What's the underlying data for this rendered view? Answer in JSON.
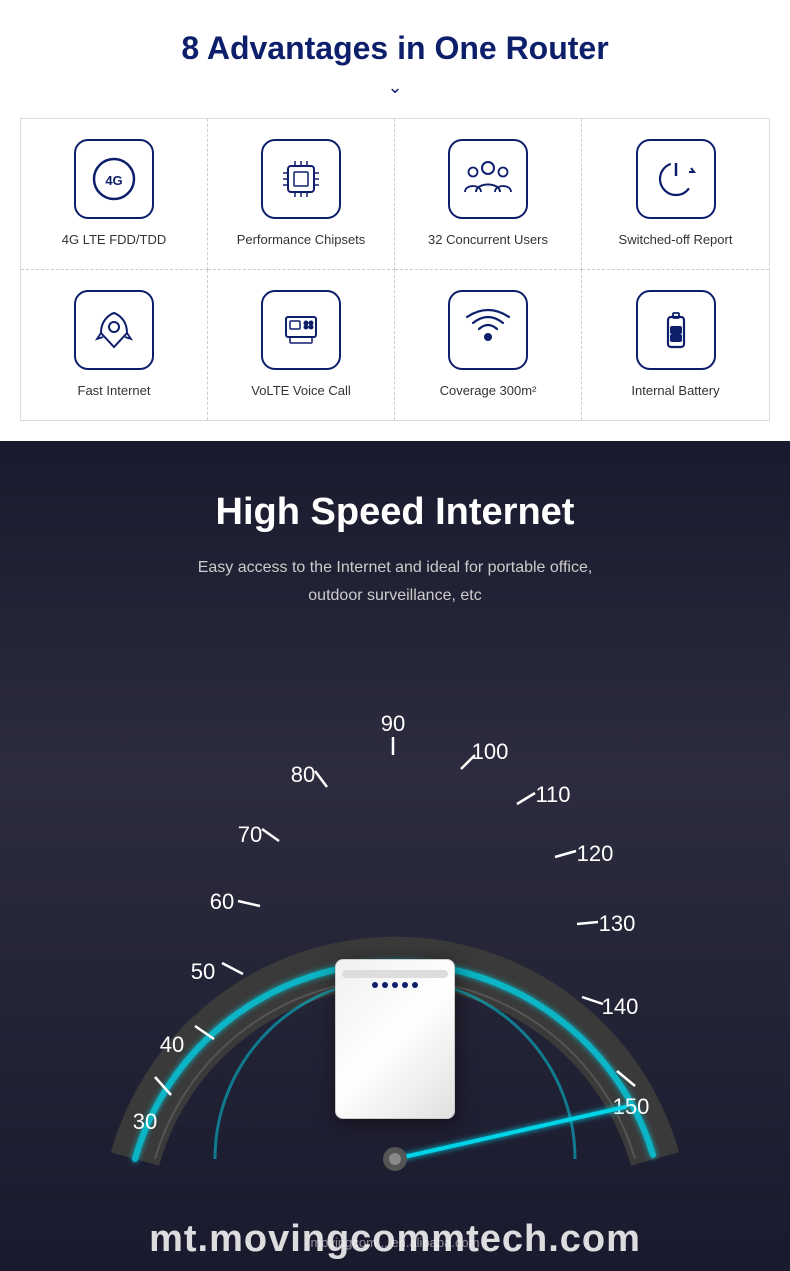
{
  "advantages": {
    "title": "8 Advantages in One Router",
    "items": [
      {
        "id": "4g-lte",
        "label": "4G LTE FDD/TDD",
        "icon": "4g"
      },
      {
        "id": "chipset",
        "label": "Performance Chipsets",
        "icon": "chip"
      },
      {
        "id": "users",
        "label": "32 Concurrent Users",
        "icon": "users"
      },
      {
        "id": "power",
        "label": "Switched-off Report",
        "icon": "power"
      },
      {
        "id": "fast-internet",
        "label": "Fast Internet",
        "icon": "rocket"
      },
      {
        "id": "volte",
        "label": "VoLTE Voice Call",
        "icon": "phone"
      },
      {
        "id": "coverage",
        "label": "Coverage 300m²",
        "icon": "wifi"
      },
      {
        "id": "battery",
        "label": "Internal Battery",
        "icon": "battery"
      }
    ]
  },
  "speed": {
    "title": "High Speed Internet",
    "subtitle_line1": "Easy access to the Internet and ideal for portable office,",
    "subtitle_line2": "outdoor surveillance, etc",
    "speedometer_labels": [
      "30",
      "40",
      "50",
      "60",
      "70",
      "80",
      "90",
      "100",
      "110",
      "120",
      "130",
      "140",
      "150"
    ],
    "needle_value": 150
  },
  "domain": {
    "text": "mt.movingcommtech.com",
    "sub": "movingcom... en.alibaba.com"
  }
}
